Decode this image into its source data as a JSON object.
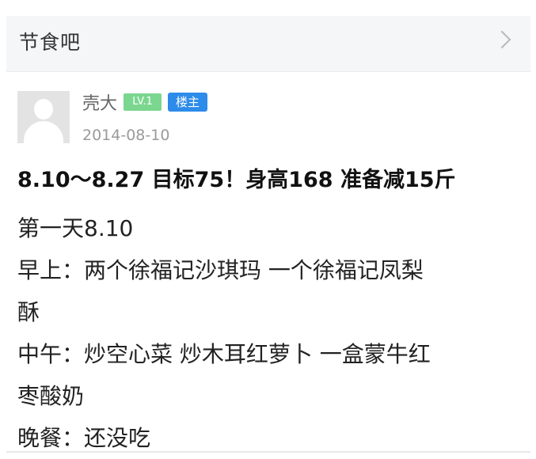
{
  "header": {
    "forum_name": "节食吧",
    "chevron_icon": "chevron-right-icon"
  },
  "post": {
    "author": {
      "name": "壳大",
      "level_badge": "LV.1",
      "owner_badge": "楼主",
      "avatar_icon": "default-avatar-icon"
    },
    "date": "2014-08-10",
    "title": "8.10～8.27 目标75！身高168 准备减15斤",
    "body_lines": [
      "第一天8.10",
      "早上：两个徐福记沙琪玛 一个徐福记凤梨",
      "酥",
      "中午：炒空心菜 炒木耳红萝卜 一盒蒙牛红",
      "枣酸奶",
      "晚餐：还没吃"
    ]
  },
  "colors": {
    "header_bg": "#f5f6f8",
    "level_badge": "#7bd68f",
    "owner_badge": "#2d8bea",
    "meta_text": "#9a9a9a"
  }
}
